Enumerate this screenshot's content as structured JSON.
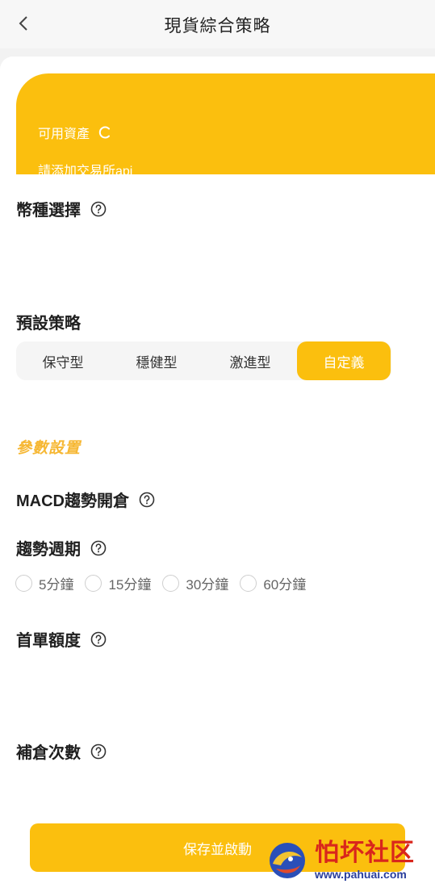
{
  "header": {
    "title": "現貨綜合策略"
  },
  "asset_card": {
    "label": "可用資產",
    "api_link": "請添加交易所api"
  },
  "coin_section": {
    "title": "幣種選擇"
  },
  "strategy_section": {
    "title": "預設策略",
    "tabs": [
      {
        "label": "保守型"
      },
      {
        "label": "穩健型"
      },
      {
        "label": "激進型"
      },
      {
        "label": "自定義"
      }
    ],
    "active_tab": "自定義"
  },
  "params": {
    "heading": "參數設置"
  },
  "macd": {
    "title": "MACD趨勢開倉"
  },
  "period": {
    "title": "趨勢週期",
    "options": [
      {
        "label": "5分鐘"
      },
      {
        "label": "15分鐘"
      },
      {
        "label": "30分鐘"
      },
      {
        "label": "60分鐘"
      }
    ]
  },
  "first_amount": {
    "title": "首單額度"
  },
  "add_count": {
    "title": "補倉次數"
  },
  "save_button": {
    "label": "保存並啟動"
  },
  "watermark": {
    "cn": "怕坏社区",
    "url": "www.pahuai.com"
  },
  "colors": {
    "accent": "#fbbf0e",
    "params_heading": "#f6b733"
  }
}
